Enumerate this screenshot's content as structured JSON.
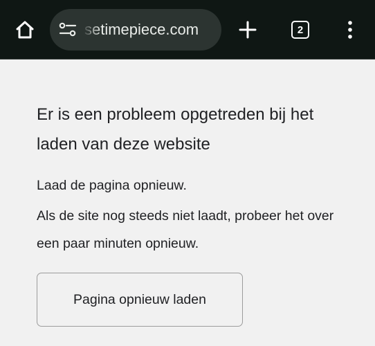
{
  "browser": {
    "url_text": "setimepiece.com",
    "tab_count": "2",
    "icons": {
      "home": "home-icon",
      "site_settings": "tune-icon",
      "new_tab": "plus-icon",
      "tabs": "tab-switcher-icon",
      "menu": "more-vert-icon"
    },
    "colors": {
      "toolbar_bg": "#0f1714",
      "omnibox_bg": "#2c3431",
      "page_bg": "#f1f1f1",
      "text": "#202124"
    }
  },
  "error_page": {
    "title": "Er is een probleem opgetreden bij het laden van deze website",
    "message_line_1": "Laad de pagina opnieuw.",
    "message_line_2": "Als de site nog steeds niet laadt, probeer het over een paar minuten opnieuw.",
    "reload_button_label": "Pagina opnieuw laden"
  }
}
